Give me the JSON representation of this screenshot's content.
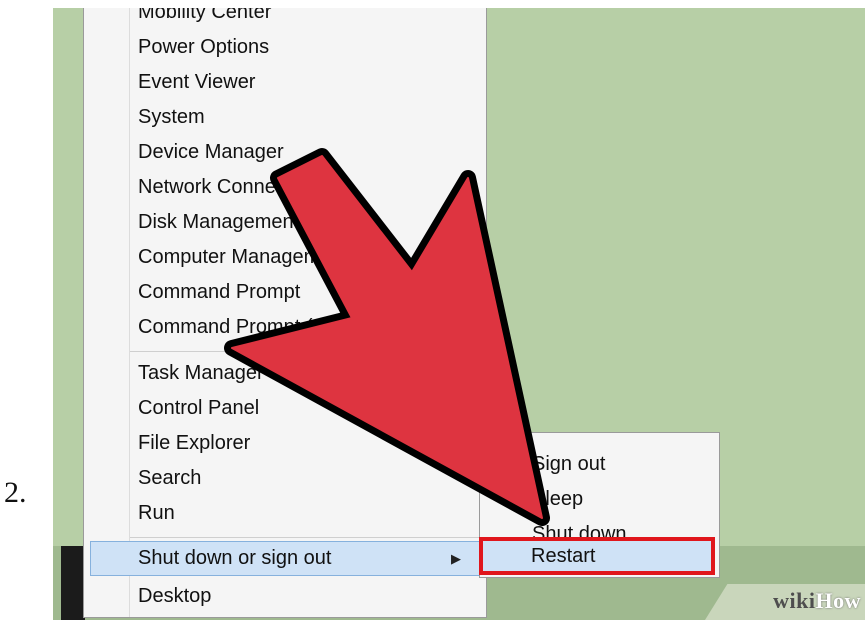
{
  "step_number": "2.",
  "context_menu": {
    "items": [
      {
        "label": "Mobility Center"
      },
      {
        "label": "Power Options"
      },
      {
        "label": "Event Viewer"
      },
      {
        "label": "System"
      },
      {
        "label": "Device Manager"
      },
      {
        "label": "Network Connections"
      },
      {
        "label": "Disk Management"
      },
      {
        "label": "Computer Management"
      },
      {
        "label": "Command Prompt"
      },
      {
        "label": "Command Prompt (Admin)"
      },
      {
        "label": "Task Manager"
      },
      {
        "label": "Control Panel"
      },
      {
        "label": "File Explorer"
      },
      {
        "label": "Search"
      },
      {
        "label": "Run"
      },
      {
        "label": "Shut down or sign out"
      },
      {
        "label": "Desktop"
      }
    ],
    "submenu_indicator": "▶"
  },
  "submenu": {
    "items": [
      {
        "label": "Sign out"
      },
      {
        "label": "Sleep"
      },
      {
        "label": "Shut down"
      },
      {
        "label": "Restart"
      }
    ]
  },
  "watermark": {
    "part1": "wiki",
    "part2": "How"
  },
  "colors": {
    "desktop": "#b7cfa6",
    "menu_bg": "#f5f5f5",
    "selected": "#cfe2f6",
    "highlight_border": "#e0161c",
    "arrow_fill": "#de3440"
  }
}
